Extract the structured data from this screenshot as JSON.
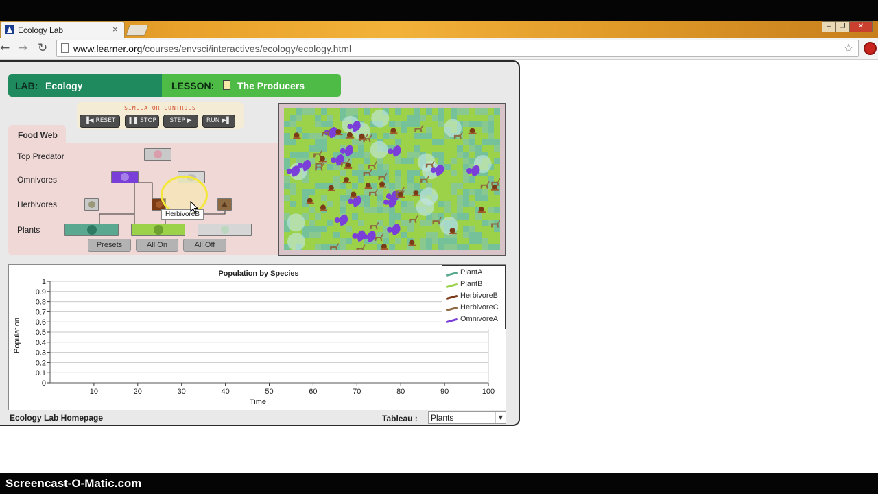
{
  "browser": {
    "tab_title": "Ecology Lab",
    "tab_close": "×",
    "url_host": "www.learner.org",
    "url_path": "/courses/envsci/interactives/ecology/ecology.html"
  },
  "app": {
    "lab_key": "LAB:",
    "lab_value": "Ecology",
    "lesson_key": "LESSON:",
    "lesson_value": "The Producers",
    "sim_controls_title": "SIMULATOR CONTROLS",
    "sim_buttons": {
      "reset": "RESET",
      "stop": "STOP",
      "step": "STEP",
      "run": "RUN"
    },
    "food_web": {
      "tab_label": "Food Web",
      "rows": {
        "top_predator": "Top Predator",
        "omnivores": "Omnivores",
        "herbivores": "Herbivores",
        "plants": "Plants"
      },
      "tooltip": "HerbivoreB",
      "buttons": {
        "presets": "Presets",
        "all_on": "All On",
        "all_off": "All Off"
      }
    },
    "footer": {
      "homepage": "Ecology Lab Homepage",
      "tableau_label": "Tableau :",
      "tableau_value": "Plants"
    }
  },
  "colors": {
    "plantA": "#5aa88f",
    "plantB": "#9bd24a",
    "herbivoreB": "#7a3b16",
    "herbivoreC": "#8e6a43",
    "omnivoreA": "#7a3fd8"
  },
  "chart_data": {
    "type": "line",
    "title": "Population by Species",
    "xlabel": "Time",
    "ylabel": "Population",
    "xlim": [
      0,
      100
    ],
    "ylim": [
      0,
      1
    ],
    "xticks": [
      10,
      20,
      30,
      40,
      50,
      60,
      70,
      80,
      90,
      100
    ],
    "yticks": [
      0,
      0.1,
      0.2,
      0.3,
      0.4,
      0.5,
      0.6,
      0.7,
      0.8,
      0.9,
      1
    ],
    "grid": true,
    "legend_position": "top-right",
    "series": [
      {
        "name": "PlantA",
        "color": "#5aa88f",
        "values": []
      },
      {
        "name": "PlantB",
        "color": "#9bd24a",
        "values": []
      },
      {
        "name": "HerbivoreB",
        "color": "#7a3b16",
        "values": []
      },
      {
        "name": "HerbivoreC",
        "color": "#8e6a43",
        "values": []
      },
      {
        "name": "OmnivoreA",
        "color": "#7a3fd8",
        "values": []
      }
    ]
  },
  "recording_watermark": "Screencast-O-Matic.com"
}
